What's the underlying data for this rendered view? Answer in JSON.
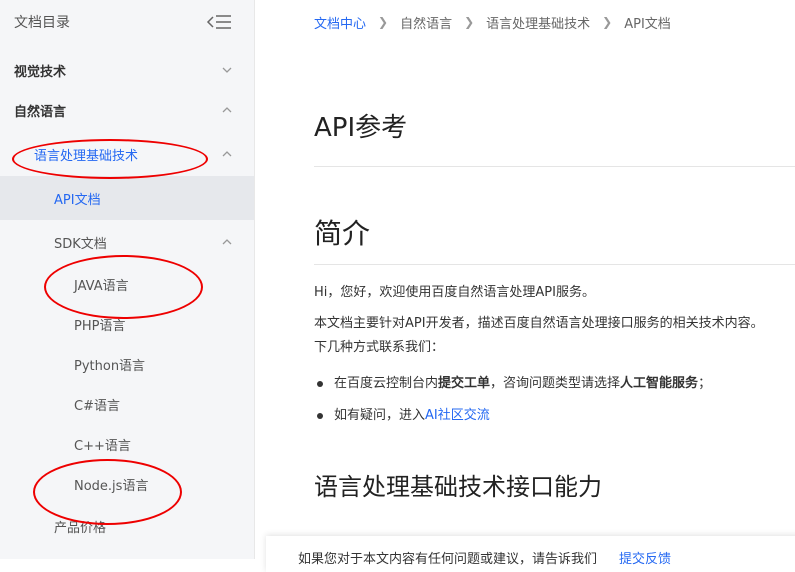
{
  "sidebar": {
    "title": "文档目录",
    "collapse_icon": "collapse-menu-icon",
    "items": [
      {
        "label": "视觉技术",
        "expanded": false
      },
      {
        "label": "自然语言",
        "expanded": true
      },
      {
        "label": "语言处理基础技术",
        "expanded": true
      },
      {
        "label": "API文档",
        "active": true
      },
      {
        "label": "SDK文档",
        "expanded": true
      },
      {
        "label": "JAVA语言"
      },
      {
        "label": "PHP语言"
      },
      {
        "label": "Python语言"
      },
      {
        "label": "C#语言"
      },
      {
        "label": "C++语言"
      },
      {
        "label": "Node.js语言"
      },
      {
        "label": "产品价格"
      }
    ]
  },
  "breadcrumb": [
    "文档中心",
    "自然语言",
    "语言处理基础技术",
    "API文档"
  ],
  "main": {
    "title": "API参考",
    "intro_heading": "简介",
    "greeting": "Hi，您好，欢迎使用百度自然语言处理API服务。",
    "desc_line1": "本文档主要针对API开发者，描述百度自然语言处理接口服务的相关技术内容。",
    "desc_line2": "下几种方式联系我们：",
    "bullet1": {
      "pre": "在百度云控制台内",
      "b1": "提交工单",
      "mid": "，咨询问题类型请选择",
      "b2": "人工智能服务",
      "post": "；"
    },
    "bullet2": {
      "pre": "如有疑问，进入",
      "link": "AI社区交流"
    },
    "section_heading": "语言处理基础技术接口能力"
  },
  "feedback": {
    "text": "如果您对于本文内容有任何问题或建议，请告诉我们",
    "link": "提交反馈"
  },
  "colors": {
    "accent": "#2468f2",
    "annotation": "#ee0000"
  }
}
